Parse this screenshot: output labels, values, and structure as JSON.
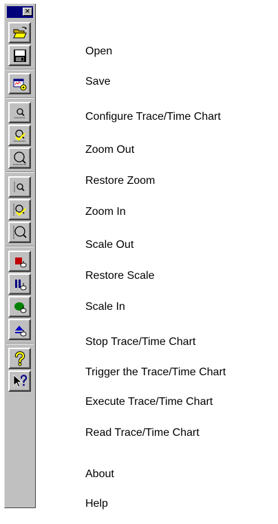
{
  "palette": {
    "close_glyph": "×",
    "title_color": "#00007b",
    "face_color": "#c0c0c0",
    "tools": [
      {
        "icon": "open-folder-icon",
        "label": "Open"
      },
      {
        "icon": "save-disk-icon",
        "label": "Save"
      },
      {
        "icon": "configure-chart-icon",
        "label": "Configure Trace/Time Chart"
      },
      {
        "icon": "zoom-out-icon",
        "label": "Zoom Out"
      },
      {
        "icon": "restore-zoom-icon",
        "label": "Restore Zoom"
      },
      {
        "icon": "zoom-in-icon",
        "label": "Zoom In"
      },
      {
        "icon": "scale-out-icon",
        "label": "Scale Out"
      },
      {
        "icon": "restore-scale-icon",
        "label": "Restore Scale"
      },
      {
        "icon": "scale-in-icon",
        "label": "Scale In"
      },
      {
        "icon": "stop-trace-icon",
        "label": "Stop Trace/Time Chart"
      },
      {
        "icon": "trigger-trace-icon",
        "label": "Trigger the Trace/Time Chart"
      },
      {
        "icon": "execute-trace-icon",
        "label": "Execute Trace/Time Chart"
      },
      {
        "icon": "read-trace-icon",
        "label": "Read Trace/Time Chart"
      },
      {
        "icon": "help-question-icon",
        "label": "About"
      },
      {
        "icon": "context-help-pointer-icon",
        "label": "Help"
      }
    ]
  }
}
